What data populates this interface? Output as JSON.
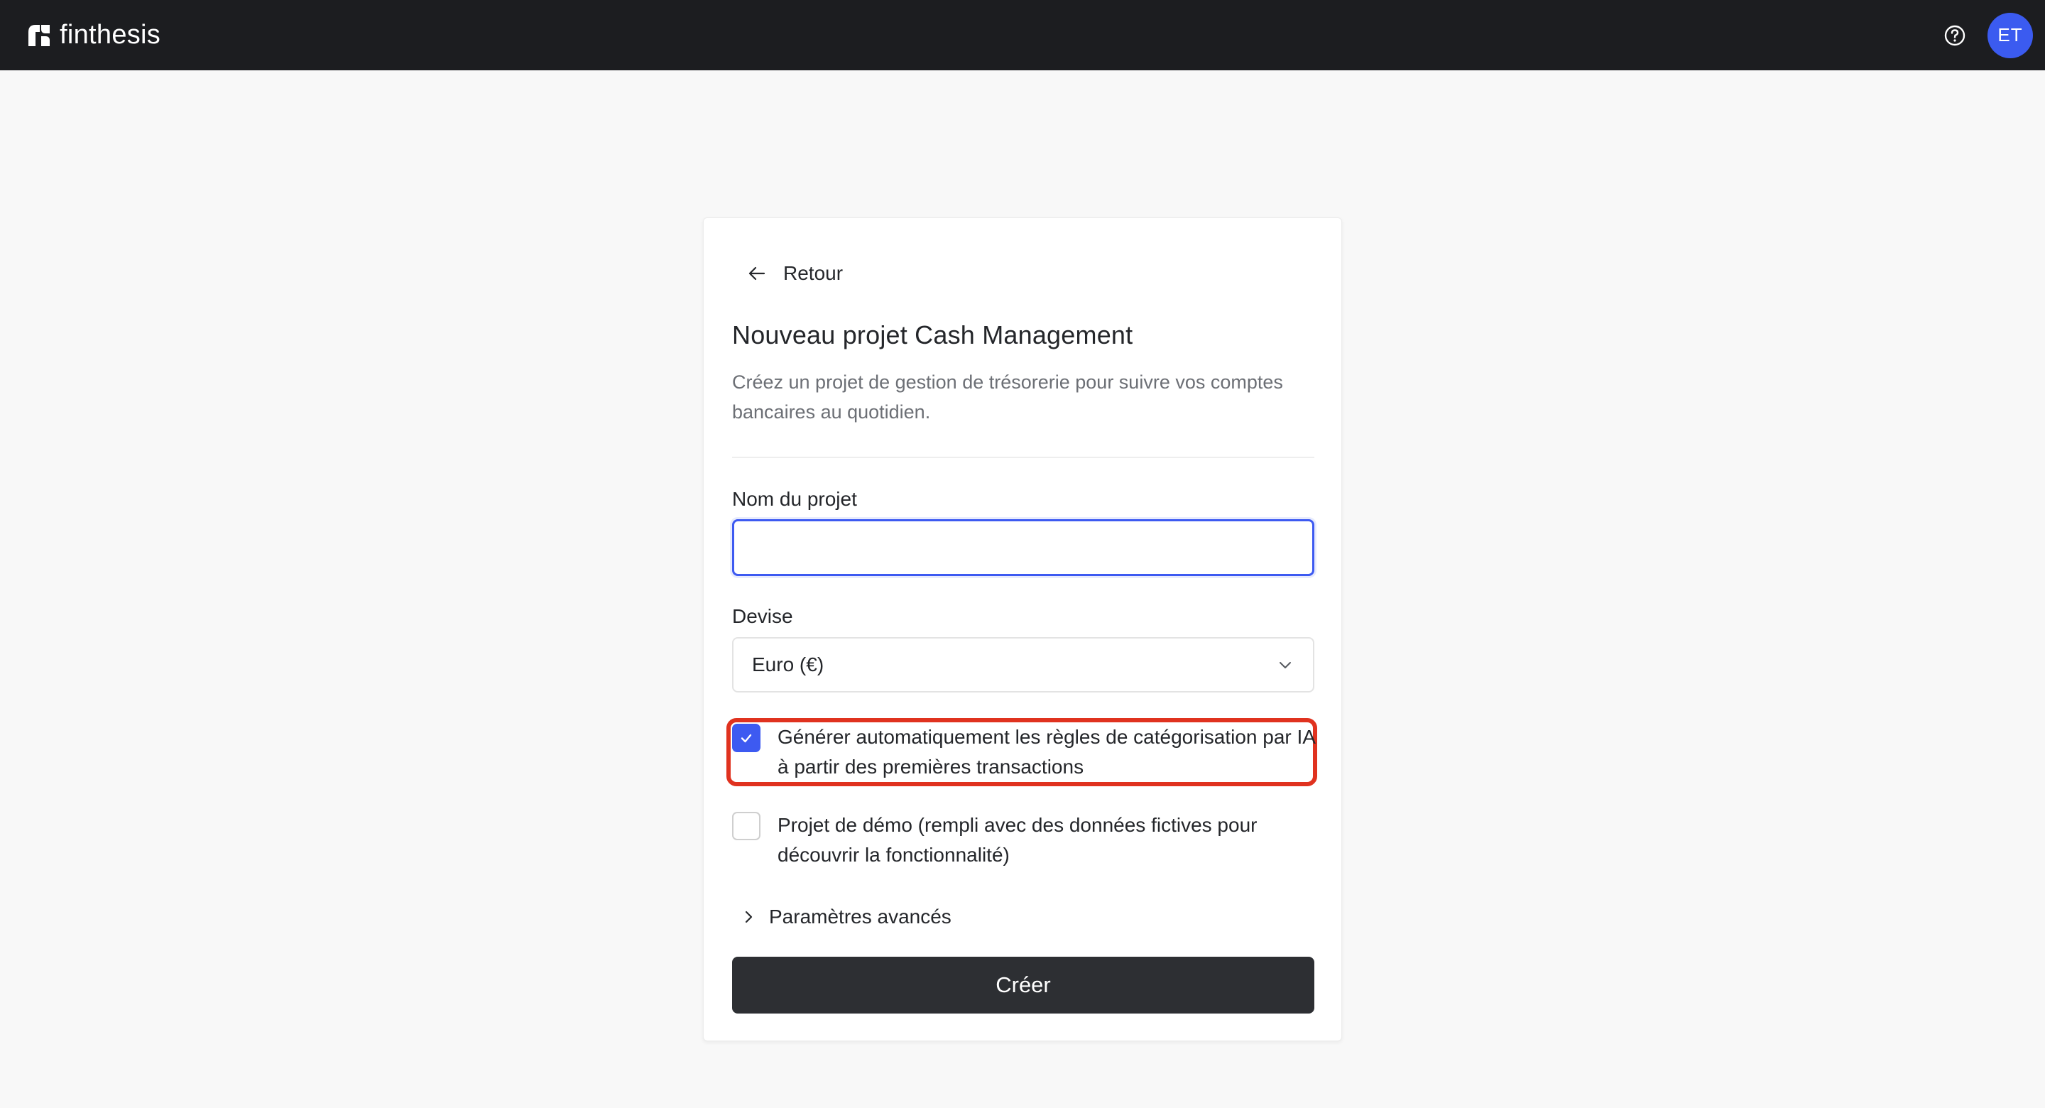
{
  "app": {
    "brand_name": "finthesis",
    "avatar_initials": "ET",
    "accent_color": "#3d5af1",
    "topbar_color": "#1c1d20"
  },
  "icons": {
    "logo": "finthesis-logo-icon",
    "help": "help-circle-icon",
    "back": "arrow-left-icon",
    "select": "chevron-down-icon",
    "checkbox": "check-icon",
    "advanced": "chevron-right-icon"
  },
  "form": {
    "back_label": "Retour",
    "title": "Nouveau projet Cash Management",
    "subtitle": "Créez un projet de gestion de trésorerie pour suivre vos comptes bancaires au quotidien.",
    "name_label": "Nom du projet",
    "name_value": "",
    "currency_label": "Devise",
    "currency_value": "Euro (€)",
    "auto_rules": {
      "label": "Générer automatiquement les règles de catégorisation par IA à partir des premières transactions",
      "checked": true,
      "highlight_color": "#e0321f"
    },
    "demo_project": {
      "label": "Projet de démo (rempli avec des données fictives pour découvrir la fonctionnalité)",
      "checked": false
    },
    "advanced_label": "Paramètres avancés",
    "submit_label": "Créer"
  }
}
